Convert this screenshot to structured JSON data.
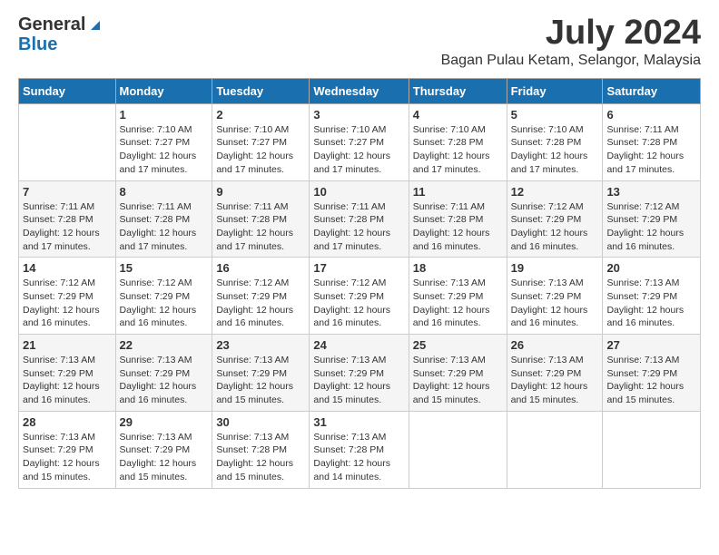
{
  "logo": {
    "general": "General",
    "blue": "Blue"
  },
  "title": {
    "month_year": "July 2024",
    "location": "Bagan Pulau Ketam, Selangor, Malaysia"
  },
  "headers": [
    "Sunday",
    "Monday",
    "Tuesday",
    "Wednesday",
    "Thursday",
    "Friday",
    "Saturday"
  ],
  "weeks": [
    [
      {
        "day": "",
        "sunrise": "",
        "sunset": "",
        "daylight": ""
      },
      {
        "day": "1",
        "sunrise": "Sunrise: 7:10 AM",
        "sunset": "Sunset: 7:27 PM",
        "daylight": "Daylight: 12 hours and 17 minutes."
      },
      {
        "day": "2",
        "sunrise": "Sunrise: 7:10 AM",
        "sunset": "Sunset: 7:27 PM",
        "daylight": "Daylight: 12 hours and 17 minutes."
      },
      {
        "day": "3",
        "sunrise": "Sunrise: 7:10 AM",
        "sunset": "Sunset: 7:27 PM",
        "daylight": "Daylight: 12 hours and 17 minutes."
      },
      {
        "day": "4",
        "sunrise": "Sunrise: 7:10 AM",
        "sunset": "Sunset: 7:28 PM",
        "daylight": "Daylight: 12 hours and 17 minutes."
      },
      {
        "day": "5",
        "sunrise": "Sunrise: 7:10 AM",
        "sunset": "Sunset: 7:28 PM",
        "daylight": "Daylight: 12 hours and 17 minutes."
      },
      {
        "day": "6",
        "sunrise": "Sunrise: 7:11 AM",
        "sunset": "Sunset: 7:28 PM",
        "daylight": "Daylight: 12 hours and 17 minutes."
      }
    ],
    [
      {
        "day": "7",
        "sunrise": "Sunrise: 7:11 AM",
        "sunset": "Sunset: 7:28 PM",
        "daylight": "Daylight: 12 hours and 17 minutes."
      },
      {
        "day": "8",
        "sunrise": "Sunrise: 7:11 AM",
        "sunset": "Sunset: 7:28 PM",
        "daylight": "Daylight: 12 hours and 17 minutes."
      },
      {
        "day": "9",
        "sunrise": "Sunrise: 7:11 AM",
        "sunset": "Sunset: 7:28 PM",
        "daylight": "Daylight: 12 hours and 17 minutes."
      },
      {
        "day": "10",
        "sunrise": "Sunrise: 7:11 AM",
        "sunset": "Sunset: 7:28 PM",
        "daylight": "Daylight: 12 hours and 17 minutes."
      },
      {
        "day": "11",
        "sunrise": "Sunrise: 7:11 AM",
        "sunset": "Sunset: 7:28 PM",
        "daylight": "Daylight: 12 hours and 16 minutes."
      },
      {
        "day": "12",
        "sunrise": "Sunrise: 7:12 AM",
        "sunset": "Sunset: 7:29 PM",
        "daylight": "Daylight: 12 hours and 16 minutes."
      },
      {
        "day": "13",
        "sunrise": "Sunrise: 7:12 AM",
        "sunset": "Sunset: 7:29 PM",
        "daylight": "Daylight: 12 hours and 16 minutes."
      }
    ],
    [
      {
        "day": "14",
        "sunrise": "Sunrise: 7:12 AM",
        "sunset": "Sunset: 7:29 PM",
        "daylight": "Daylight: 12 hours and 16 minutes."
      },
      {
        "day": "15",
        "sunrise": "Sunrise: 7:12 AM",
        "sunset": "Sunset: 7:29 PM",
        "daylight": "Daylight: 12 hours and 16 minutes."
      },
      {
        "day": "16",
        "sunrise": "Sunrise: 7:12 AM",
        "sunset": "Sunset: 7:29 PM",
        "daylight": "Daylight: 12 hours and 16 minutes."
      },
      {
        "day": "17",
        "sunrise": "Sunrise: 7:12 AM",
        "sunset": "Sunset: 7:29 PM",
        "daylight": "Daylight: 12 hours and 16 minutes."
      },
      {
        "day": "18",
        "sunrise": "Sunrise: 7:13 AM",
        "sunset": "Sunset: 7:29 PM",
        "daylight": "Daylight: 12 hours and 16 minutes."
      },
      {
        "day": "19",
        "sunrise": "Sunrise: 7:13 AM",
        "sunset": "Sunset: 7:29 PM",
        "daylight": "Daylight: 12 hours and 16 minutes."
      },
      {
        "day": "20",
        "sunrise": "Sunrise: 7:13 AM",
        "sunset": "Sunset: 7:29 PM",
        "daylight": "Daylight: 12 hours and 16 minutes."
      }
    ],
    [
      {
        "day": "21",
        "sunrise": "Sunrise: 7:13 AM",
        "sunset": "Sunset: 7:29 PM",
        "daylight": "Daylight: 12 hours and 16 minutes."
      },
      {
        "day": "22",
        "sunrise": "Sunrise: 7:13 AM",
        "sunset": "Sunset: 7:29 PM",
        "daylight": "Daylight: 12 hours and 16 minutes."
      },
      {
        "day": "23",
        "sunrise": "Sunrise: 7:13 AM",
        "sunset": "Sunset: 7:29 PM",
        "daylight": "Daylight: 12 hours and 15 minutes."
      },
      {
        "day": "24",
        "sunrise": "Sunrise: 7:13 AM",
        "sunset": "Sunset: 7:29 PM",
        "daylight": "Daylight: 12 hours and 15 minutes."
      },
      {
        "day": "25",
        "sunrise": "Sunrise: 7:13 AM",
        "sunset": "Sunset: 7:29 PM",
        "daylight": "Daylight: 12 hours and 15 minutes."
      },
      {
        "day": "26",
        "sunrise": "Sunrise: 7:13 AM",
        "sunset": "Sunset: 7:29 PM",
        "daylight": "Daylight: 12 hours and 15 minutes."
      },
      {
        "day": "27",
        "sunrise": "Sunrise: 7:13 AM",
        "sunset": "Sunset: 7:29 PM",
        "daylight": "Daylight: 12 hours and 15 minutes."
      }
    ],
    [
      {
        "day": "28",
        "sunrise": "Sunrise: 7:13 AM",
        "sunset": "Sunset: 7:29 PM",
        "daylight": "Daylight: 12 hours and 15 minutes."
      },
      {
        "day": "29",
        "sunrise": "Sunrise: 7:13 AM",
        "sunset": "Sunset: 7:29 PM",
        "daylight": "Daylight: 12 hours and 15 minutes."
      },
      {
        "day": "30",
        "sunrise": "Sunrise: 7:13 AM",
        "sunset": "Sunset: 7:28 PM",
        "daylight": "Daylight: 12 hours and 15 minutes."
      },
      {
        "day": "31",
        "sunrise": "Sunrise: 7:13 AM",
        "sunset": "Sunset: 7:28 PM",
        "daylight": "Daylight: 12 hours and 14 minutes."
      },
      {
        "day": "",
        "sunrise": "",
        "sunset": "",
        "daylight": ""
      },
      {
        "day": "",
        "sunrise": "",
        "sunset": "",
        "daylight": ""
      },
      {
        "day": "",
        "sunrise": "",
        "sunset": "",
        "daylight": ""
      }
    ]
  ]
}
